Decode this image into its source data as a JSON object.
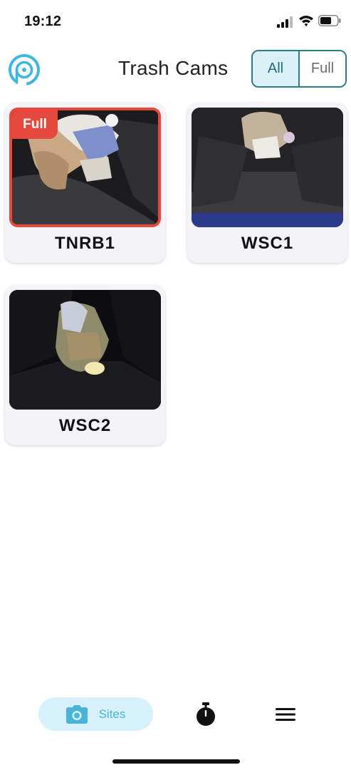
{
  "status_bar": {
    "time": "19:12",
    "icons": [
      "signal-icon",
      "wifi-icon",
      "battery-icon"
    ]
  },
  "header": {
    "title": "Trash Cams",
    "logo_icon": "app-logo-icon",
    "filter": {
      "options": [
        "All",
        "Full"
      ],
      "selected": "All"
    }
  },
  "cards": [
    {
      "label": "TNRB1",
      "full": true,
      "badge": "Full"
    },
    {
      "label": "WSC1",
      "full": false
    },
    {
      "label": "WSC2",
      "full": false
    }
  ],
  "bottom_nav": {
    "sites_label": "Sites",
    "sites_icon": "camera-icon",
    "timer_icon": "stopwatch-icon",
    "menu_icon": "hamburger-menu-icon"
  },
  "colors": {
    "accent": "#2a7a8c",
    "accent_light": "#d8f0f6",
    "full_red": "#e5483c",
    "nav_active_bg": "#d6f1f9",
    "nav_active_text": "#4ab5d6"
  }
}
